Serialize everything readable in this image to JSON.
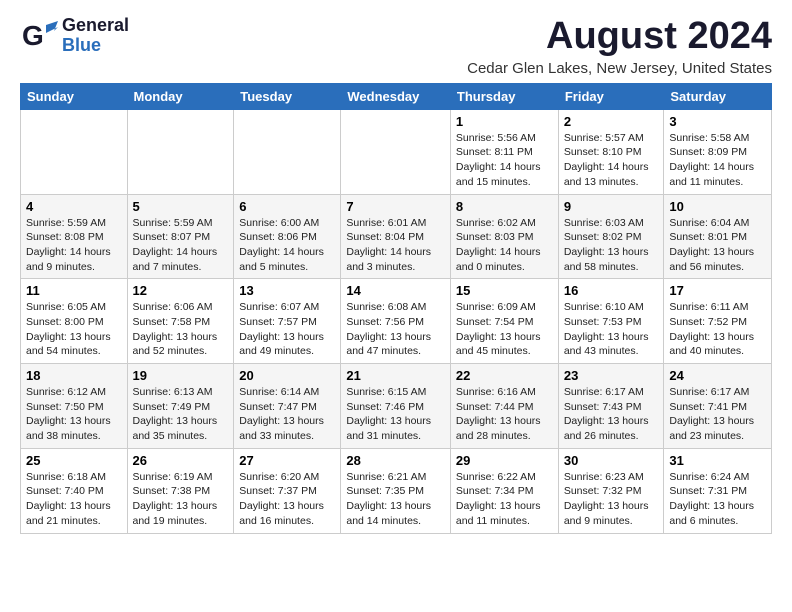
{
  "logo": {
    "line1": "General",
    "line2": "Blue"
  },
  "title": "August 2024",
  "subtitle": "Cedar Glen Lakes, New Jersey, United States",
  "weekdays": [
    "Sunday",
    "Monday",
    "Tuesday",
    "Wednesday",
    "Thursday",
    "Friday",
    "Saturday"
  ],
  "weeks": [
    [
      {
        "day": "",
        "info": ""
      },
      {
        "day": "",
        "info": ""
      },
      {
        "day": "",
        "info": ""
      },
      {
        "day": "",
        "info": ""
      },
      {
        "day": "1",
        "info": "Sunrise: 5:56 AM\nSunset: 8:11 PM\nDaylight: 14 hours\nand 15 minutes."
      },
      {
        "day": "2",
        "info": "Sunrise: 5:57 AM\nSunset: 8:10 PM\nDaylight: 14 hours\nand 13 minutes."
      },
      {
        "day": "3",
        "info": "Sunrise: 5:58 AM\nSunset: 8:09 PM\nDaylight: 14 hours\nand 11 minutes."
      }
    ],
    [
      {
        "day": "4",
        "info": "Sunrise: 5:59 AM\nSunset: 8:08 PM\nDaylight: 14 hours\nand 9 minutes."
      },
      {
        "day": "5",
        "info": "Sunrise: 5:59 AM\nSunset: 8:07 PM\nDaylight: 14 hours\nand 7 minutes."
      },
      {
        "day": "6",
        "info": "Sunrise: 6:00 AM\nSunset: 8:06 PM\nDaylight: 14 hours\nand 5 minutes."
      },
      {
        "day": "7",
        "info": "Sunrise: 6:01 AM\nSunset: 8:04 PM\nDaylight: 14 hours\nand 3 minutes."
      },
      {
        "day": "8",
        "info": "Sunrise: 6:02 AM\nSunset: 8:03 PM\nDaylight: 14 hours\nand 0 minutes."
      },
      {
        "day": "9",
        "info": "Sunrise: 6:03 AM\nSunset: 8:02 PM\nDaylight: 13 hours\nand 58 minutes."
      },
      {
        "day": "10",
        "info": "Sunrise: 6:04 AM\nSunset: 8:01 PM\nDaylight: 13 hours\nand 56 minutes."
      }
    ],
    [
      {
        "day": "11",
        "info": "Sunrise: 6:05 AM\nSunset: 8:00 PM\nDaylight: 13 hours\nand 54 minutes."
      },
      {
        "day": "12",
        "info": "Sunrise: 6:06 AM\nSunset: 7:58 PM\nDaylight: 13 hours\nand 52 minutes."
      },
      {
        "day": "13",
        "info": "Sunrise: 6:07 AM\nSunset: 7:57 PM\nDaylight: 13 hours\nand 49 minutes."
      },
      {
        "day": "14",
        "info": "Sunrise: 6:08 AM\nSunset: 7:56 PM\nDaylight: 13 hours\nand 47 minutes."
      },
      {
        "day": "15",
        "info": "Sunrise: 6:09 AM\nSunset: 7:54 PM\nDaylight: 13 hours\nand 45 minutes."
      },
      {
        "day": "16",
        "info": "Sunrise: 6:10 AM\nSunset: 7:53 PM\nDaylight: 13 hours\nand 43 minutes."
      },
      {
        "day": "17",
        "info": "Sunrise: 6:11 AM\nSunset: 7:52 PM\nDaylight: 13 hours\nand 40 minutes."
      }
    ],
    [
      {
        "day": "18",
        "info": "Sunrise: 6:12 AM\nSunset: 7:50 PM\nDaylight: 13 hours\nand 38 minutes."
      },
      {
        "day": "19",
        "info": "Sunrise: 6:13 AM\nSunset: 7:49 PM\nDaylight: 13 hours\nand 35 minutes."
      },
      {
        "day": "20",
        "info": "Sunrise: 6:14 AM\nSunset: 7:47 PM\nDaylight: 13 hours\nand 33 minutes."
      },
      {
        "day": "21",
        "info": "Sunrise: 6:15 AM\nSunset: 7:46 PM\nDaylight: 13 hours\nand 31 minutes."
      },
      {
        "day": "22",
        "info": "Sunrise: 6:16 AM\nSunset: 7:44 PM\nDaylight: 13 hours\nand 28 minutes."
      },
      {
        "day": "23",
        "info": "Sunrise: 6:17 AM\nSunset: 7:43 PM\nDaylight: 13 hours\nand 26 minutes."
      },
      {
        "day": "24",
        "info": "Sunrise: 6:17 AM\nSunset: 7:41 PM\nDaylight: 13 hours\nand 23 minutes."
      }
    ],
    [
      {
        "day": "25",
        "info": "Sunrise: 6:18 AM\nSunset: 7:40 PM\nDaylight: 13 hours\nand 21 minutes."
      },
      {
        "day": "26",
        "info": "Sunrise: 6:19 AM\nSunset: 7:38 PM\nDaylight: 13 hours\nand 19 minutes."
      },
      {
        "day": "27",
        "info": "Sunrise: 6:20 AM\nSunset: 7:37 PM\nDaylight: 13 hours\nand 16 minutes."
      },
      {
        "day": "28",
        "info": "Sunrise: 6:21 AM\nSunset: 7:35 PM\nDaylight: 13 hours\nand 14 minutes."
      },
      {
        "day": "29",
        "info": "Sunrise: 6:22 AM\nSunset: 7:34 PM\nDaylight: 13 hours\nand 11 minutes."
      },
      {
        "day": "30",
        "info": "Sunrise: 6:23 AM\nSunset: 7:32 PM\nDaylight: 13 hours\nand 9 minutes."
      },
      {
        "day": "31",
        "info": "Sunrise: 6:24 AM\nSunset: 7:31 PM\nDaylight: 13 hours\nand 6 minutes."
      }
    ]
  ]
}
